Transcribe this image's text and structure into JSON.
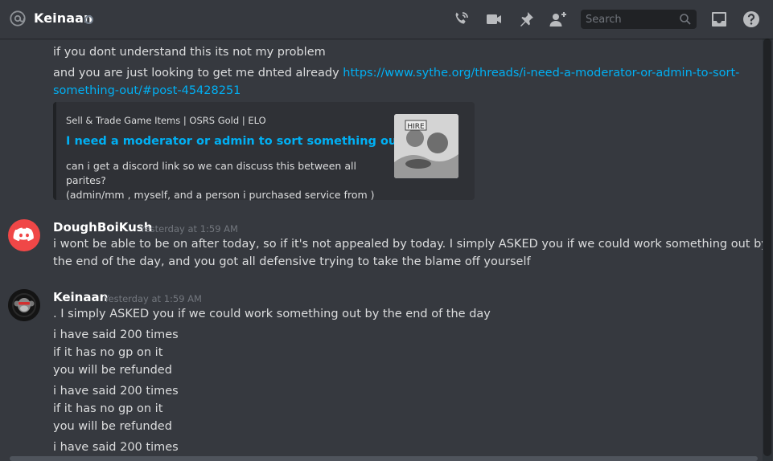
{
  "header": {
    "channel_name": "Keinaan",
    "search_placeholder": "Search",
    "icons": [
      "at-icon",
      "phone-call-icon",
      "video-call-icon",
      "pin-icon",
      "add-friend-icon",
      "search-icon",
      "inbox-icon",
      "help-icon"
    ]
  },
  "messages": {
    "continued": {
      "line1": "if you dont understand this its not my problem",
      "line2_text": "and you are just looking to get me dnted already ",
      "link_line1": "https://www.sythe.org/threads/i-need-a-moderator-or-admin-to-sort-",
      "link_line2": "something-out/#post-45428251",
      "embed": {
        "provider": "Sell & Trade Game Items | OSRS Gold | ELO",
        "title": "I need a moderator or admin to sort something out",
        "desc_line1": "can i get a discord link so we can discuss this between all parites?",
        "desc_line2": "(admin/mm , myself, and a person i purchased service from )",
        "thumbnail_text": "HIRE"
      }
    },
    "dough": {
      "author": "DoughBoiKush",
      "timestamp": "Yesterday at 1:59 AM",
      "line1": "i wont be able to be on after today, so if it's not appealed by today. I simply ASKED you if we could work something out by",
      "line2": "the end of the day, and you got all defensive trying to take the blame off yourself"
    },
    "keinaan": {
      "author": "Keinaan",
      "timestamp": "Yesterday at 1:59 AM",
      "lines": [
        ". I simply ASKED you if we could work something out by the end of the day",
        "i have said 200 times",
        "if it has no gp on it",
        "you will be refunded",
        "i have said 200 times",
        "if it has no gp on it",
        "you will be refunded",
        "i have said 200 times"
      ]
    }
  },
  "colors": {
    "background": "#36393f",
    "link": "#00b0f4",
    "discord_red": "#f04747",
    "muted": "#72767d"
  }
}
